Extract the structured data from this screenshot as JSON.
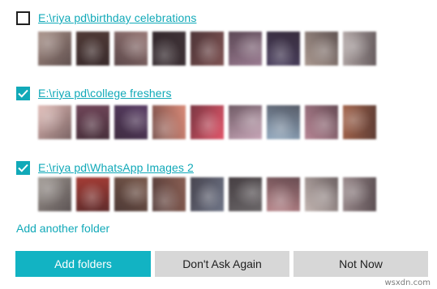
{
  "folders": [
    {
      "path": "E:\\riya pd\\birthday celebrations",
      "checked": false,
      "thumbnail_colors": [
        "#a58d84",
        "#4f3a36",
        "#9a7a78",
        "#3e3236",
        "#7e5252",
        "#9b7c92",
        "#4a3f5e",
        "#a9988f",
        "#b2a7a6"
      ]
    },
    {
      "path": "E:\\riya pd\\college freshers",
      "checked": true,
      "thumbnail_colors": [
        "#e0b9b4",
        "#6f4558",
        "#5a3e66",
        "#d98a78",
        "#e1566a",
        "#c8a6b8",
        "#8fa6bc",
        "#b68594",
        "#a2634a"
      ]
    },
    {
      "path": "E:\\riya pd\\WhatsApp Images 2",
      "checked": true,
      "thumbnail_colors": [
        "#9d9690",
        "#a43c35",
        "#7a5a4c",
        "#8a5f53",
        "#6e7486",
        "#6a6668",
        "#b68388",
        "#c3b6b2",
        "#9a8a8c"
      ]
    }
  ],
  "add_folder_link": "Add another folder",
  "buttons": {
    "add_folders": "Add folders",
    "dont_ask_again": "Don't Ask Again",
    "not_now": "Not Now"
  },
  "accent_color": "#11a9b8",
  "watermark": "wsxdn.com"
}
